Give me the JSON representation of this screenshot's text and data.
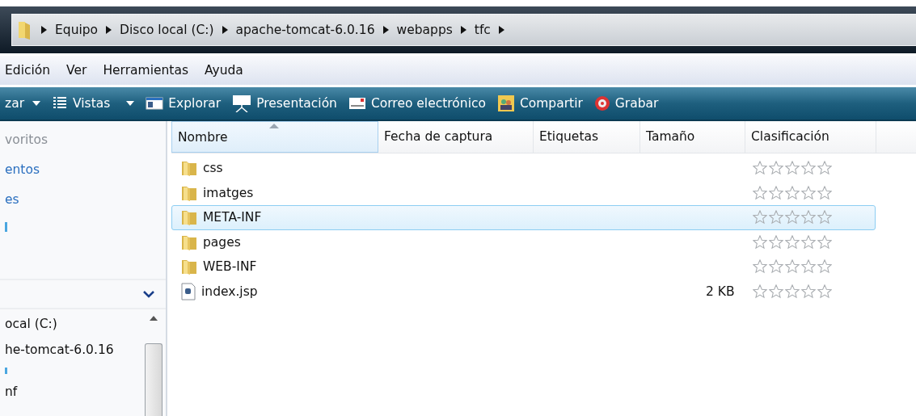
{
  "address_bar": {
    "crumbs": [
      "Equipo",
      "Disco local (C:)",
      "apache-tomcat-6.0.16",
      "webapps",
      "tfc"
    ]
  },
  "menu_bar": [
    "Edición",
    "Ver",
    "Herramientas",
    "Ayuda"
  ],
  "toolbar": [
    {
      "label": "zar",
      "kind": "dropdown"
    },
    {
      "label": "Vistas",
      "kind": "views"
    },
    {
      "label": "Explorar",
      "kind": "explore"
    },
    {
      "label": "Presentación",
      "kind": "slideshow"
    },
    {
      "label": "Correo electrónico",
      "kind": "mail"
    },
    {
      "label": "Compartir",
      "kind": "share"
    },
    {
      "label": "Grabar",
      "kind": "burn"
    }
  ],
  "sidebar": {
    "links": [
      {
        "label": "voritos",
        "kind": "heading"
      },
      {
        "label": "entos",
        "kind": "link"
      },
      {
        "label": "es",
        "kind": "link"
      }
    ],
    "folders_tree": [
      "ocal (C:)",
      "he-tomcat-6.0.16",
      "nf"
    ]
  },
  "table": {
    "columns": [
      "Nombre",
      "Fecha de captura",
      "Etiquetas",
      "Tamaño",
      "Clasificación"
    ],
    "rows": [
      {
        "name": "css",
        "kind": "folder",
        "size": "",
        "stars": 0,
        "selected": false
      },
      {
        "name": "imatges",
        "kind": "folder",
        "size": "",
        "stars": 0,
        "selected": false
      },
      {
        "name": "META-INF",
        "kind": "folder",
        "size": "",
        "stars": 0,
        "selected": true
      },
      {
        "name": "pages",
        "kind": "folder",
        "size": "",
        "stars": 0,
        "selected": false
      },
      {
        "name": "WEB-INF",
        "kind": "folder",
        "size": "",
        "stars": 0,
        "selected": false
      },
      {
        "name": "index.jsp",
        "kind": "file",
        "size": "2 KB",
        "stars": 0,
        "selected": false
      }
    ]
  }
}
